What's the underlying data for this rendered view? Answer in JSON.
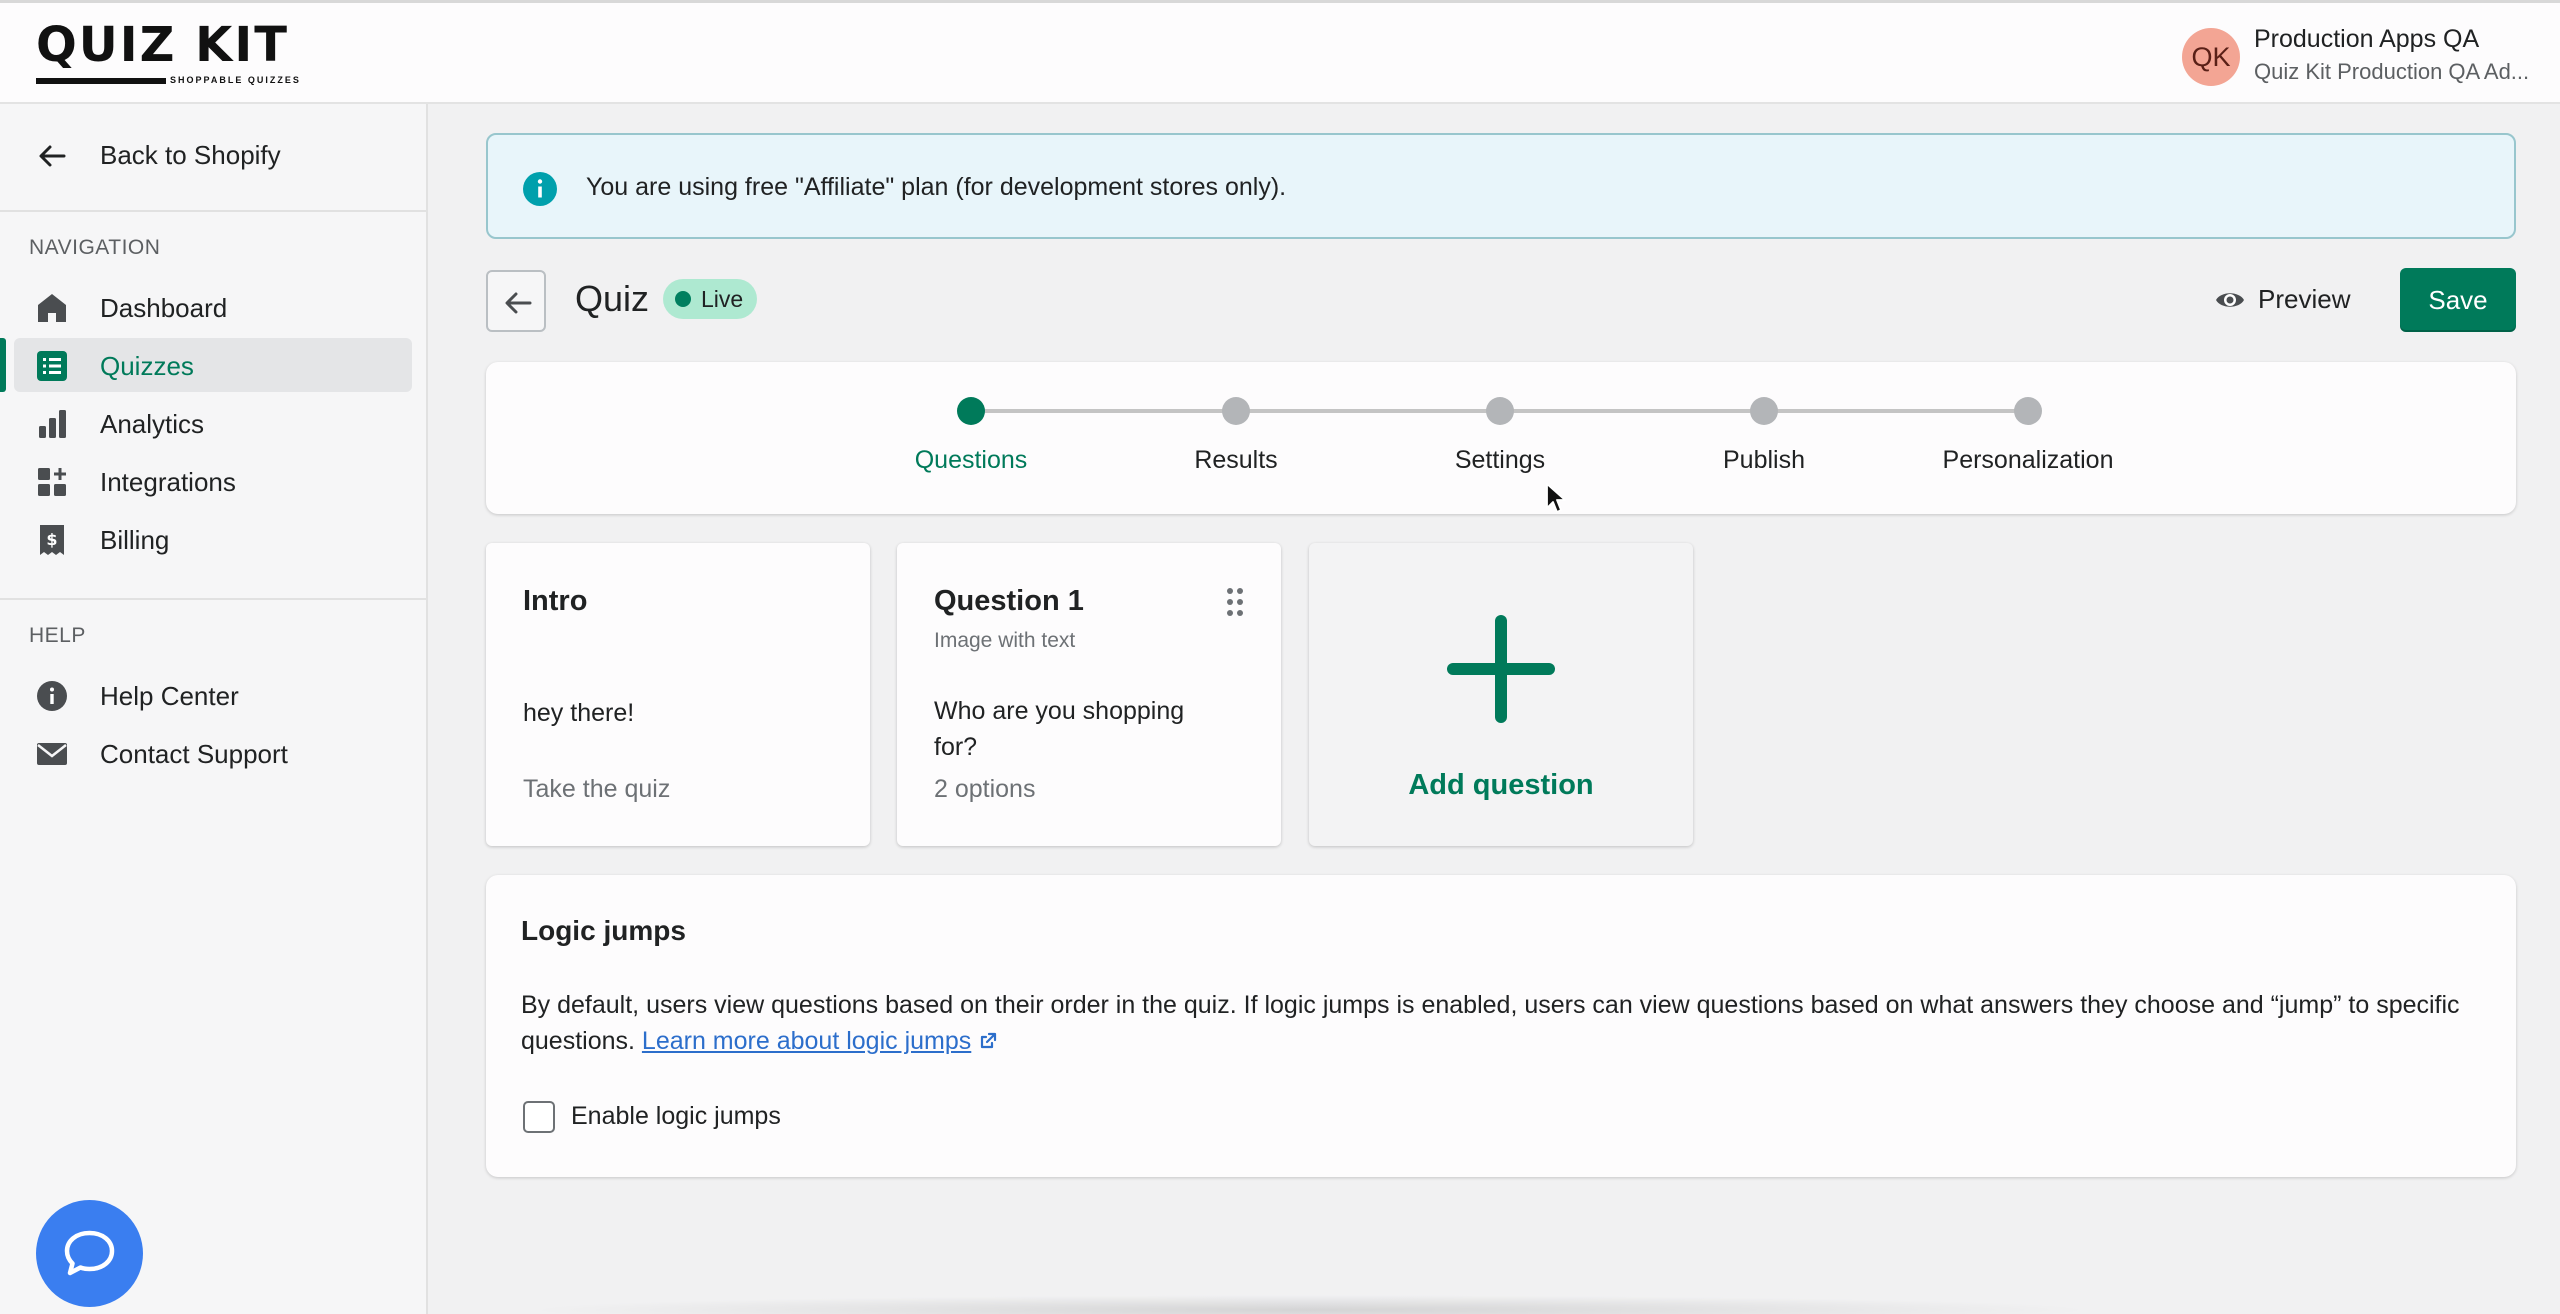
{
  "brand": {
    "logo_text": "QUIZ KIT",
    "logo_subtitle": "SHOPPABLE QUIZZES"
  },
  "account": {
    "initials": "QK",
    "name": "Production Apps QA",
    "subtitle": "Quiz Kit Production QA Ad..."
  },
  "sidebar": {
    "back_label": "Back to Shopify",
    "navigation_heading": "NAVIGATION",
    "nav_items": [
      {
        "label": "Dashboard",
        "icon": "home-icon"
      },
      {
        "label": "Quizzes",
        "icon": "list-icon",
        "active": true
      },
      {
        "label": "Analytics",
        "icon": "bar-chart-icon"
      },
      {
        "label": "Integrations",
        "icon": "apps-icon"
      },
      {
        "label": "Billing",
        "icon": "receipt-icon"
      }
    ],
    "help_heading": "HELP",
    "help_items": [
      {
        "label": "Help Center",
        "icon": "info-icon"
      },
      {
        "label": "Contact Support",
        "icon": "mail-icon"
      }
    ]
  },
  "banner": {
    "text": "You are using free \"Affiliate\" plan (for development stores only)."
  },
  "header": {
    "title": "Quiz",
    "status": "Live",
    "preview_label": "Preview",
    "save_label": "Save"
  },
  "steps": [
    {
      "label": "Questions",
      "active": true
    },
    {
      "label": "Results"
    },
    {
      "label": "Settings"
    },
    {
      "label": "Publish"
    },
    {
      "label": "Personalization"
    }
  ],
  "cards": {
    "intro": {
      "title": "Intro",
      "body": "hey there!",
      "footer": "Take the quiz"
    },
    "question1": {
      "title": "Question 1",
      "type": "Image with text",
      "body": "Who are you shopping for?",
      "footer": "2 options"
    },
    "add_label": "Add question"
  },
  "logic": {
    "title": "Logic jumps",
    "description": "By default, users view questions based on their order in the quiz. If logic jumps is enabled, users can view questions based on what answers they choose and “jump” to specific questions.",
    "link_text": "Learn more about logic jumps",
    "checkbox_label": "Enable logic jumps",
    "checkbox_checked": false
  },
  "colors": {
    "accent": "#007a5a",
    "banner_bg": "#e8f5fa",
    "chat_button": "#3a7ef0"
  }
}
